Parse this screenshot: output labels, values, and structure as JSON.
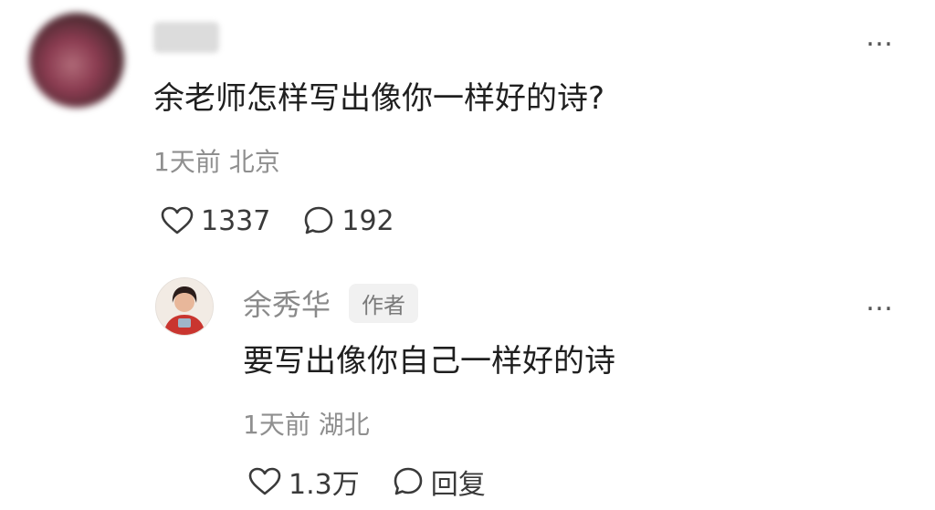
{
  "comment": {
    "text": "余老师怎样写出像你一样好的诗?",
    "time_location": "1天前 北京",
    "likes": "1337",
    "replies": "192",
    "more_icon": "…"
  },
  "reply": {
    "author": "余秀华",
    "author_badge": "作者",
    "text": "要写出像你自己一样好的诗",
    "time_location": "1天前 湖北",
    "likes": "1.3万",
    "reply_label": "回复",
    "more_icon": "…"
  },
  "icons": {
    "like": "heart-outline-icon",
    "comment": "speech-bubble-icon",
    "more": "more-dots-icon"
  },
  "colors": {
    "text_primary": "#1f1f1f",
    "text_secondary": "#8f8f8f",
    "badge_bg": "#f1f1f1"
  }
}
